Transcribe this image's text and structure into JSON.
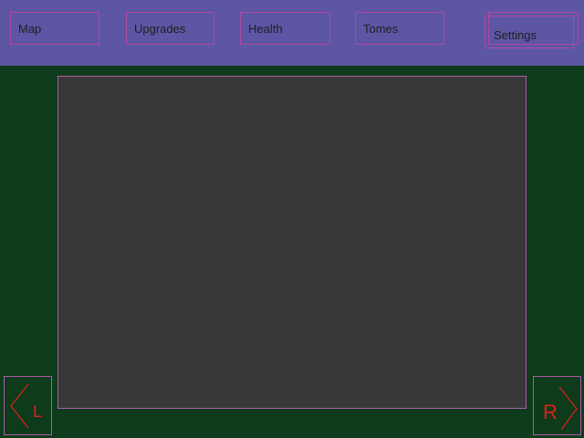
{
  "nav": {
    "map": "Map",
    "upgrades": "Upgrades",
    "health": "Health",
    "tomes": "Tomes",
    "settings": "Settings"
  },
  "controls": {
    "left_letter": "L",
    "right_letter": "R",
    "left_icon": "chevron-left-icon",
    "right_icon": "chevron-right-icon"
  },
  "colors": {
    "background": "#0d3b1b",
    "topbar": "#5c56a5",
    "button_border": "#b4479f",
    "stage": "#383838",
    "stage_border": "#b05aa8",
    "arrow_stroke": "#e0201a"
  }
}
